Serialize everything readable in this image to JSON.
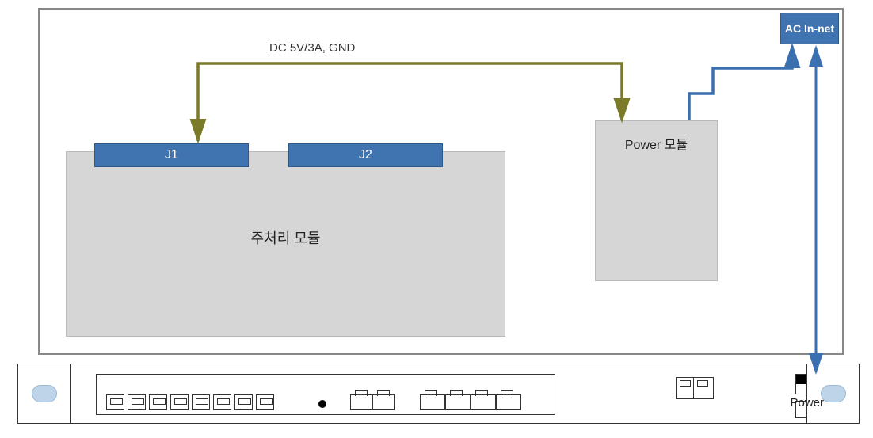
{
  "diagram": {
    "ac_inlet_label": "AC In-net",
    "dc_line_label": "DC 5V/3A, GND",
    "main_module_label": "주처리 모듈",
    "power_module_label": "Power 모듈",
    "j1_label": "J1",
    "j2_label": "J2",
    "front_panel": {
      "power_label": "Power"
    }
  }
}
